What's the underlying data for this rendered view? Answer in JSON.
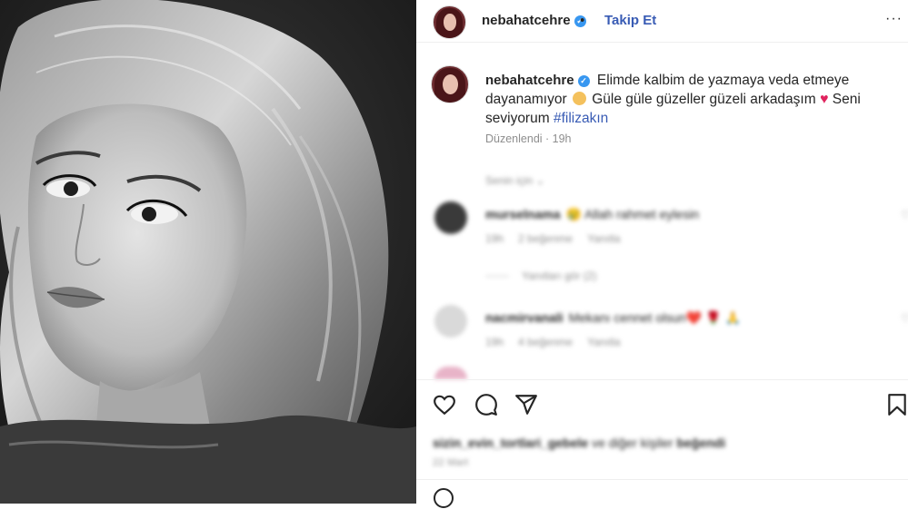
{
  "post": {
    "username": "nebahatcehre",
    "separator": "•",
    "follow_label": "Takip Et",
    "more_label": "···"
  },
  "caption": {
    "username": "nebahatcehre",
    "part1": "Elimde kalbim de yazmaya veda etmeye dayanamıyor",
    "part2": "Güle güle güzeller güzeli arkadaşım",
    "part3": "Seni seviyorum",
    "hashtag": "#filizakın",
    "edited_label": "Düzenlendi",
    "time": "19h"
  },
  "see_translation": "Senin için ⌄",
  "comments": [
    {
      "user": "murselnama",
      "text": "😢 Allah rahmet eylesin",
      "time": "19h",
      "likes": "2 beğenme",
      "reply": "Yanıtla",
      "avatar_color": "#3a3a3a"
    },
    {
      "user": "nacmirvanali",
      "text": "Mekanı cennet olsun❤️ 🌹 🙏",
      "time": "19h",
      "likes": "4 beğenme",
      "reply": "Yanıtla",
      "avatar_color": "#d9d9d9"
    }
  ],
  "view_replies": "Yanıtları gör (2)",
  "likes_line": {
    "users": "sizin_evin_tortlari_gebele",
    "rest": "ve diğer kişiler",
    "suffix": "beğendi"
  },
  "date": "22 Mart",
  "icons": [
    "heart-icon",
    "comment-icon",
    "share-icon",
    "bookmark-icon",
    "more-icon",
    "verified-icon",
    "emoji-icon"
  ],
  "colors": {
    "link_blue": "#385bb4",
    "verified_blue": "#3897f0",
    "heart_red": "#e0245e",
    "muted": "#8e8e8e"
  }
}
